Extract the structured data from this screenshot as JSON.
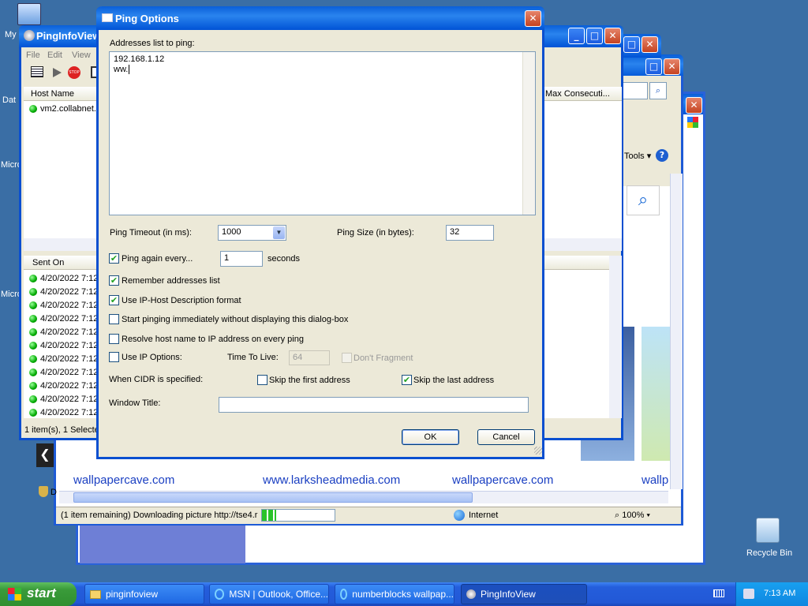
{
  "desktop": {
    "icons": [
      {
        "label": "My"
      },
      {
        "label": "Dat"
      },
      {
        "label": "Micro"
      },
      {
        "label": "Micro"
      },
      {
        "label": "Recycle Bin"
      }
    ]
  },
  "pinginfoview": {
    "title": "PingInfoView",
    "menu": [
      "File",
      "Edit",
      "View"
    ],
    "col_host": "Host Name",
    "col_maxcons": "Max Consecuti...",
    "host_row": "vm2.collabnet.l",
    "col_sent": "Sent On",
    "sent_rows": [
      "4/20/2022 7:12",
      "4/20/2022 7:12",
      "4/20/2022 7:12",
      "4/20/2022 7:12",
      "4/20/2022 7:12",
      "4/20/2022 7:12",
      "4/20/2022 7:12",
      "4/20/2022 7:12",
      "4/20/2022 7:12",
      "4/20/2022 7:12",
      "4/20/2022 7:12"
    ],
    "status": "1 item(s), 1 Selecte"
  },
  "browser": {
    "tools_label": "Tools",
    "links": [
      "wallpapercave.com",
      "www.larksheadmedia.com",
      "wallpapercave.com",
      "wallp"
    ],
    "status_text": "(1 item remaining) Downloading picture http://tse4.r",
    "progress": 0.2,
    "zone": "Internet",
    "zoom": "100%",
    "side_letter": "D"
  },
  "dialog": {
    "title": "Ping Options",
    "addresses_label": "Addresses list to ping:",
    "addresses": [
      "192.168.1.12",
      "ww."
    ],
    "timeout_label": "Ping Timeout (in ms):",
    "timeout_value": "1000",
    "size_label": "Ping Size (in bytes):",
    "size_value": "32",
    "ping_again_label": "Ping again every...",
    "ping_again_value": "1",
    "seconds_label": "seconds",
    "remember_label": "Remember addresses list",
    "iphost_label": "Use IP-Host Description format",
    "start_label": "Start pinging immediately without displaying this dialog-box",
    "resolve_label": "Resolve host name to IP address on every ping",
    "ipoptions_label": "Use IP Options:",
    "ttl_label": "Time To Live:",
    "ttl_value": "64",
    "dontfrag_label": "Don't Fragment",
    "cidr_label": "When CIDR is specified:",
    "skip_first_label": "Skip the first address",
    "skip_last_label": "Skip the last address",
    "window_title_label": "Window Title:",
    "window_title_value": "",
    "ok_label": "OK",
    "cancel_label": "Cancel"
  },
  "taskbar": {
    "start_label": "start",
    "tasks": [
      "pinginfoview",
      "MSN | Outlook, Office...",
      "numberblocks wallpap...",
      "PingInfoView"
    ],
    "clock": "7:13 AM"
  }
}
